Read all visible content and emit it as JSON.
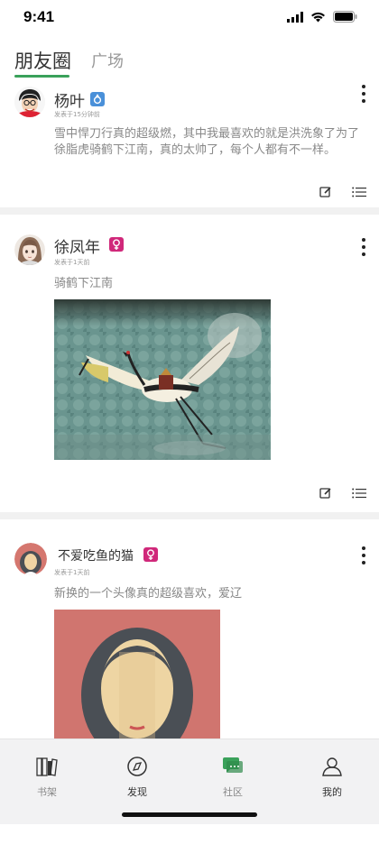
{
  "status": {
    "time": "9:41"
  },
  "tabs": {
    "friends": "朋友圈",
    "square": "广场"
  },
  "posts": [
    {
      "name": "杨叶",
      "time": "发表于15分钟前",
      "text": "雪中悍刀行真的超级燃，其中我最喜欢的就是洪洗象了为了徐脂虎骑鹤下江南，真的太帅了，每个人都有不一样。"
    },
    {
      "name": "徐凤年",
      "time": "发表于1天前",
      "text": "骑鹤下江南"
    },
    {
      "name": "不爱吃鱼的猫",
      "time": "发表于1天前",
      "text": "新换的一个头像真的超级喜欢，爱辽"
    }
  ],
  "nav": [
    {
      "label": "书架",
      "icon": "bookshelf-icon"
    },
    {
      "label": "发现",
      "icon": "compass-icon"
    },
    {
      "label": "社区",
      "icon": "chat-bubble-icon"
    },
    {
      "label": "我的",
      "icon": "person-icon"
    }
  ],
  "colors": {
    "accent": "#3aa15a",
    "male_badge": "#4a90d9",
    "female_badge": "#d0287a"
  }
}
